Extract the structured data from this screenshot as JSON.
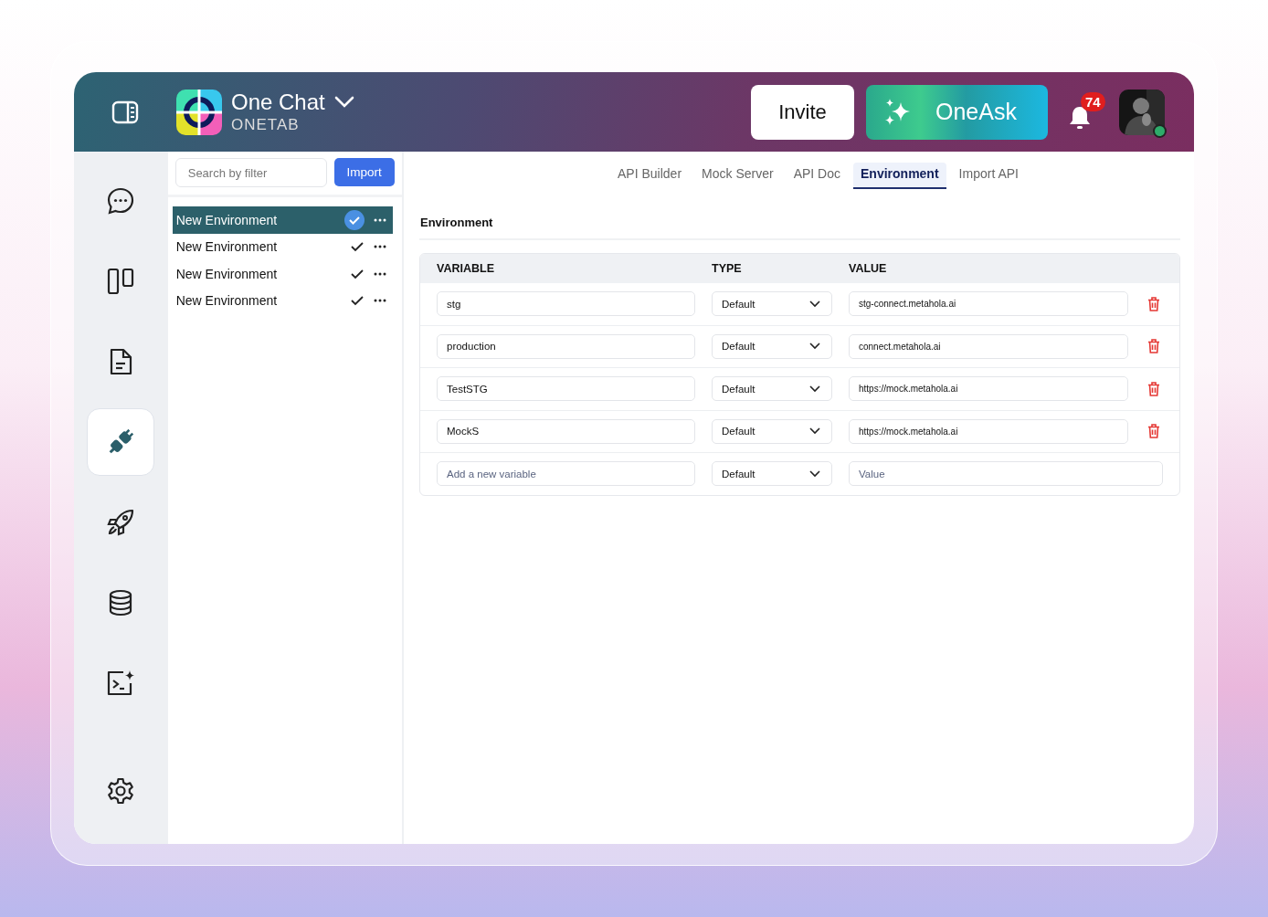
{
  "header": {
    "app_name": "One Chat",
    "workspace": "ONETAB",
    "invite_button": "Invite",
    "ask_button": "OneAsk",
    "notification_count": "74",
    "user_online": true
  },
  "rail": [
    {
      "selected": false
    },
    {
      "selected": false
    },
    {
      "selected": false
    },
    {
      "selected": true
    },
    {
      "selected": false
    },
    {
      "selected": false
    },
    {
      "selected": false
    },
    {
      "selected": false
    }
  ],
  "environments": {
    "search": {
      "placeholder": "Search by filter"
    },
    "import_button": "Import",
    "items": [
      {
        "label": "New Environment",
        "selected": true
      },
      {
        "label": "New Environment",
        "selected": false
      },
      {
        "label": "New Environment",
        "selected": false
      },
      {
        "label": "New Environment",
        "selected": false
      }
    ]
  },
  "tabs": [
    {
      "label": "API Builder",
      "selected": false
    },
    {
      "label": "Mock Server",
      "selected": false
    },
    {
      "label": "API Doc",
      "selected": false
    },
    {
      "label": "Environment",
      "selected": true
    },
    {
      "label": "Import API",
      "selected": false
    }
  ],
  "section_title": "Environment",
  "table": {
    "columns": [
      "VARIABLE",
      "TYPE",
      "VALUE"
    ],
    "rows": [
      {
        "variable": "stg",
        "type": "Default",
        "value": "stg-connect.metahola.ai"
      },
      {
        "variable": "production",
        "type": "Default",
        "value": "connect.metahola.ai"
      },
      {
        "variable": "TestSTG",
        "type": "Default",
        "value": "https://mock.metahola.ai"
      },
      {
        "variable": "MockS",
        "type": "Default",
        "value": "https://mock.metahola.ai"
      }
    ],
    "new_row": {
      "variable_placeholder": "Add a new variable",
      "type": "Default",
      "value_placeholder": "Value"
    }
  }
}
